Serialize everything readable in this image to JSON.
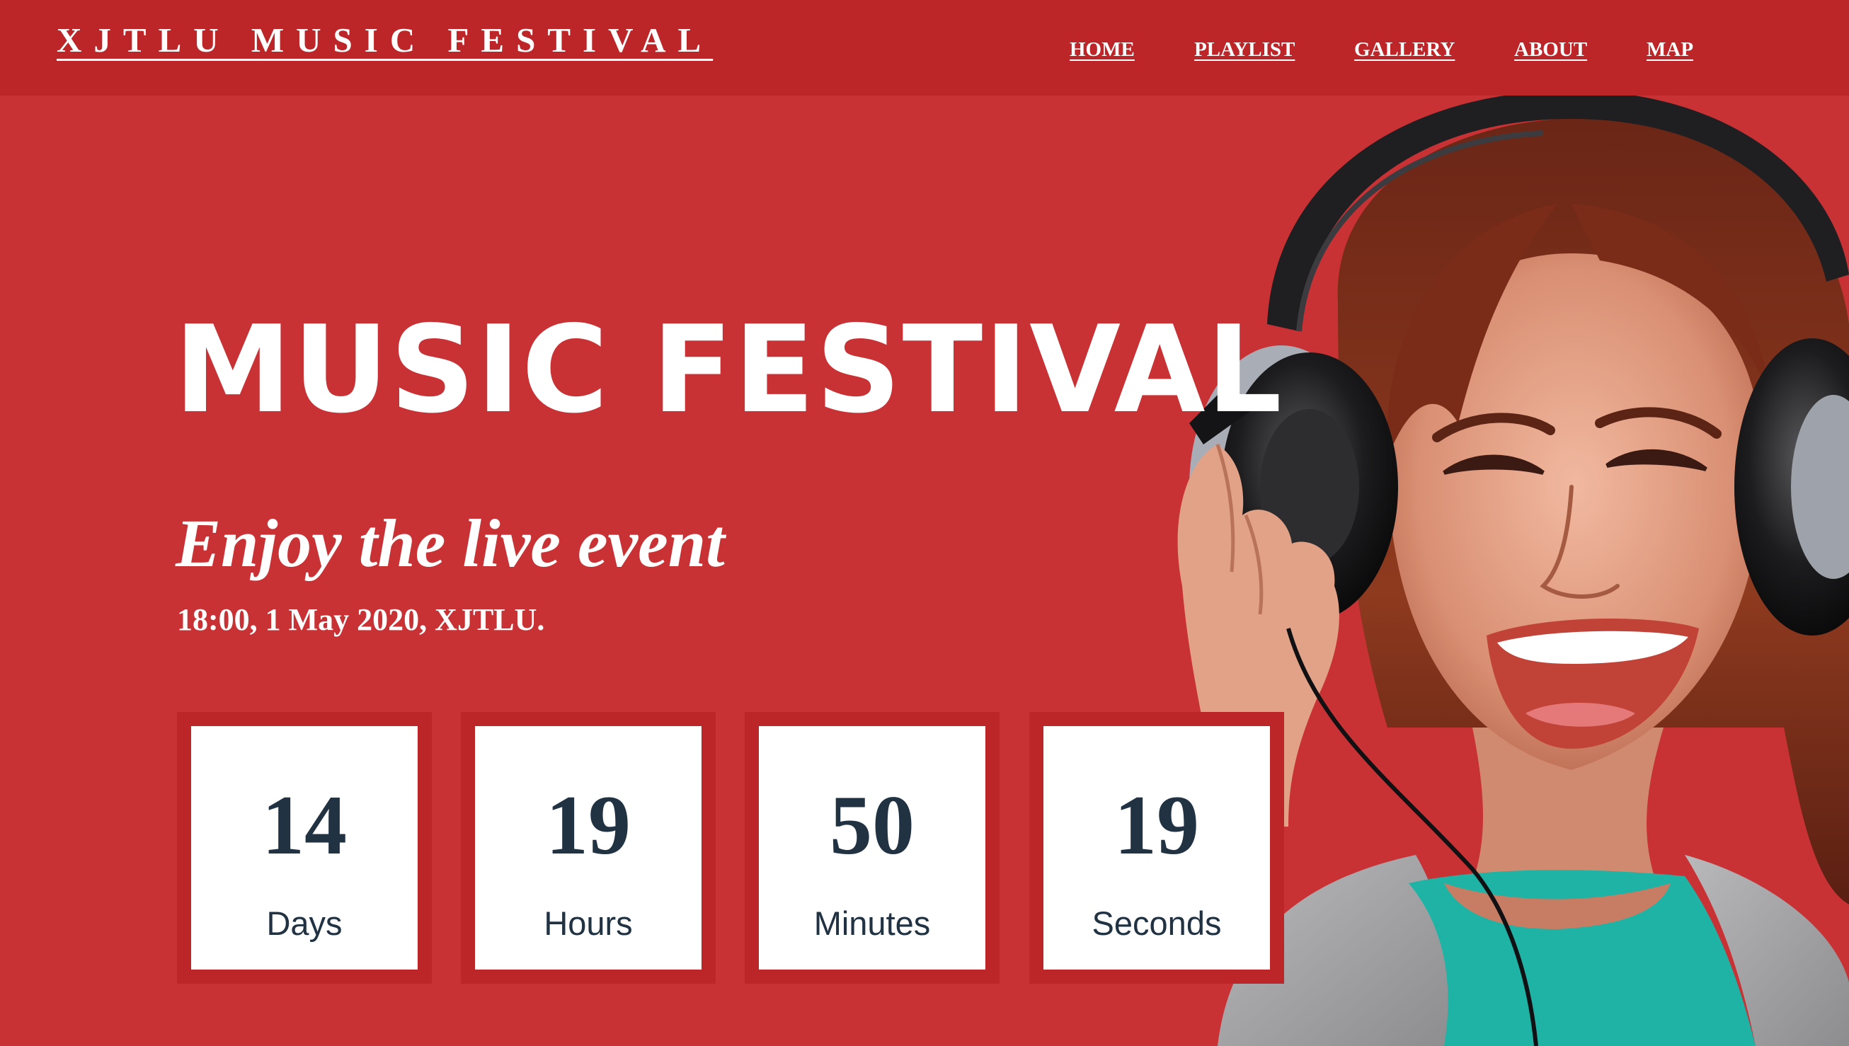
{
  "header": {
    "brand": "XJTLU MUSIC FESTIVAL",
    "nav": [
      {
        "label": "HOME"
      },
      {
        "label": "PLAYLIST"
      },
      {
        "label": "GALLERY"
      },
      {
        "label": "ABOUT"
      },
      {
        "label": "MAP"
      }
    ]
  },
  "hero": {
    "title": "MUSIC FESTIVAL",
    "subtitle": "Enjoy the live event",
    "datetime": "18:00, 1 May 2020, XJTLU."
  },
  "countdown": [
    {
      "value": "14",
      "label": "Days"
    },
    {
      "value": "19",
      "label": "Hours"
    },
    {
      "value": "50",
      "label": "Minutes"
    },
    {
      "value": "19",
      "label": "Seconds"
    }
  ],
  "colors": {
    "background": "#c93235",
    "header": "#bd2629",
    "box_border": "#bd2629",
    "countdown_text": "#213243",
    "text_light": "#ffffff"
  },
  "icons": {
    "hero_image": "woman-with-headphones-photo"
  }
}
